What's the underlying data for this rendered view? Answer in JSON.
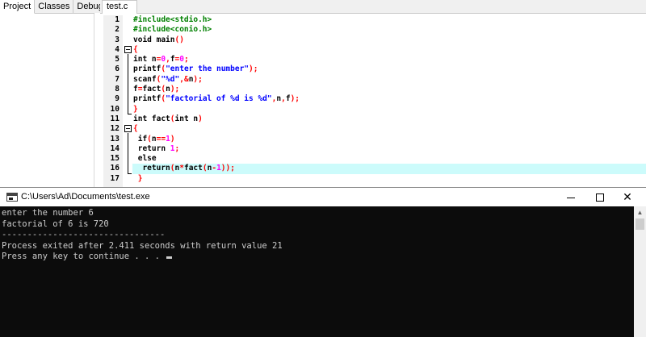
{
  "left_panel": {
    "tabs": [
      {
        "label": "Project",
        "active": true
      },
      {
        "label": "Classes",
        "active": false
      },
      {
        "label": "Debug",
        "active": false
      }
    ]
  },
  "editor": {
    "file_tab": "test.c",
    "highlighted_line": 16,
    "lines": [
      {
        "n": "1",
        "tokens": [
          {
            "t": "#include<stdio.h>",
            "c": "pre"
          }
        ]
      },
      {
        "n": "2",
        "tokens": [
          {
            "t": "#include<conio.h>",
            "c": "pre"
          }
        ]
      },
      {
        "n": "3",
        "tokens": [
          {
            "t": "void main",
            "c": "kw"
          },
          {
            "t": "()",
            "c": "pun"
          }
        ]
      },
      {
        "n": "4",
        "tokens": [
          {
            "t": "{",
            "c": "pun"
          }
        ]
      },
      {
        "n": "5",
        "tokens": [
          {
            "t": "int n",
            "c": "kw"
          },
          {
            "t": "=",
            "c": "pun"
          },
          {
            "t": "0",
            "c": "num"
          },
          {
            "t": ",",
            "c": "pun"
          },
          {
            "t": "f",
            "c": "txt"
          },
          {
            "t": "=",
            "c": "pun"
          },
          {
            "t": "0",
            "c": "num"
          },
          {
            "t": ";",
            "c": "pun"
          }
        ]
      },
      {
        "n": "6",
        "tokens": [
          {
            "t": "printf",
            "c": "txt"
          },
          {
            "t": "(",
            "c": "pun"
          },
          {
            "t": "\"enter the number\"",
            "c": "str"
          },
          {
            "t": ");",
            "c": "pun"
          }
        ]
      },
      {
        "n": "7",
        "tokens": [
          {
            "t": "scanf",
            "c": "txt"
          },
          {
            "t": "(",
            "c": "pun"
          },
          {
            "t": "\"%d\"",
            "c": "str"
          },
          {
            "t": ",&",
            "c": "pun"
          },
          {
            "t": "n",
            "c": "txt"
          },
          {
            "t": ");",
            "c": "pun"
          }
        ]
      },
      {
        "n": "8",
        "tokens": [
          {
            "t": "f",
            "c": "txt"
          },
          {
            "t": "=",
            "c": "pun"
          },
          {
            "t": "fact",
            "c": "txt"
          },
          {
            "t": "(",
            "c": "pun"
          },
          {
            "t": "n",
            "c": "txt"
          },
          {
            "t": ");",
            "c": "pun"
          }
        ]
      },
      {
        "n": "9",
        "tokens": [
          {
            "t": "printf",
            "c": "txt"
          },
          {
            "t": "(",
            "c": "pun"
          },
          {
            "t": "\"factorial of %d is %d\"",
            "c": "str"
          },
          {
            "t": ",",
            "c": "pun"
          },
          {
            "t": "n",
            "c": "txt"
          },
          {
            "t": ",",
            "c": "pun"
          },
          {
            "t": "f",
            "c": "txt"
          },
          {
            "t": ");",
            "c": "pun"
          }
        ]
      },
      {
        "n": "10",
        "tokens": [
          {
            "t": "}",
            "c": "pun"
          }
        ]
      },
      {
        "n": "11",
        "tokens": [
          {
            "t": "int fact",
            "c": "kw"
          },
          {
            "t": "(",
            "c": "pun"
          },
          {
            "t": "int n",
            "c": "kw"
          },
          {
            "t": ")",
            "c": "pun"
          }
        ]
      },
      {
        "n": "12",
        "tokens": [
          {
            "t": "{",
            "c": "pun"
          }
        ]
      },
      {
        "n": "13",
        "tokens": [
          {
            "t": " if",
            "c": "kw"
          },
          {
            "t": "(",
            "c": "pun"
          },
          {
            "t": "n",
            "c": "txt"
          },
          {
            "t": "==",
            "c": "pun"
          },
          {
            "t": "1",
            "c": "num"
          },
          {
            "t": ")",
            "c": "pun"
          }
        ]
      },
      {
        "n": "14",
        "tokens": [
          {
            "t": " return ",
            "c": "kw"
          },
          {
            "t": "1",
            "c": "num"
          },
          {
            "t": ";",
            "c": "pun"
          }
        ]
      },
      {
        "n": "15",
        "tokens": [
          {
            "t": " else",
            "c": "kw"
          }
        ]
      },
      {
        "n": "16",
        "tokens": [
          {
            "t": "  return",
            "c": "kw"
          },
          {
            "t": "(",
            "c": "pun"
          },
          {
            "t": "n",
            "c": "txt"
          },
          {
            "t": "*",
            "c": "pun"
          },
          {
            "t": "fact",
            "c": "txt"
          },
          {
            "t": "(",
            "c": "pun"
          },
          {
            "t": "n",
            "c": "txt"
          },
          {
            "t": "-",
            "c": "pun"
          },
          {
            "t": "1",
            "c": "num"
          },
          {
            "t": "));",
            "c": "pun"
          }
        ]
      },
      {
        "n": "17",
        "tokens": [
          {
            "t": " }",
            "c": "pun"
          }
        ]
      }
    ]
  },
  "console": {
    "title": "C:\\Users\\Ad\\Documents\\test.exe",
    "minimize": "",
    "close": "✕",
    "output": [
      "enter the number 6",
      "factorial of 6 is 720",
      "--------------------------------",
      "Process exited after 2.411 seconds with return value 21",
      "Press any key to continue . . . "
    ],
    "scroll_up": "▲"
  },
  "colors": {
    "preprocessor": "#008000",
    "string": "#0000ff",
    "number": "#ff00ff",
    "punctuation": "#ff0000",
    "highlight": "#ccfbfb",
    "terminal_bg": "#0c0c0c",
    "terminal_fg": "#cccccc"
  }
}
